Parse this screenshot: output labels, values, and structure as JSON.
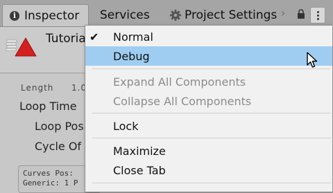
{
  "tabs": {
    "inspector": "Inspector",
    "services": "Services",
    "project_settings": "Project Settings"
  },
  "inspector": {
    "object_title": "Tutoria",
    "length_label": "Length",
    "length_value": "1.0",
    "loop_time_label": "Loop Time",
    "loop_pose_label": "Loop Pos",
    "cycle_offset_label": "Cycle Of",
    "curves_text": "Curves Pos:",
    "generic_text": "Generic: 1 P"
  },
  "menu": {
    "normal": "Normal",
    "debug": "Debug",
    "expand_all": "Expand All Components",
    "collapse_all": "Collapse All Components",
    "lock": "Lock",
    "maximize": "Maximize",
    "close_tab": "Close Tab",
    "checked_item": "Normal",
    "hovered_item": "Debug"
  },
  "colors": {
    "highlight": "#9fcdf1",
    "warning_red": "#d32020",
    "menu_bg": "#f1f1f1"
  },
  "icons": [
    "info-icon",
    "gear-icon",
    "lock-icon",
    "kebab-menu-icon",
    "checkmark-icon",
    "warning-icon",
    "stack-icon",
    "mouse-cursor-icon"
  ]
}
